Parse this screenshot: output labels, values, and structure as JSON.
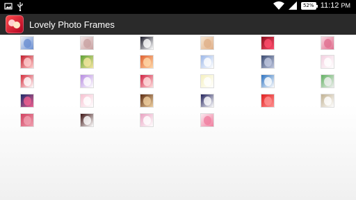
{
  "status_bar": {
    "time": "11:12",
    "time_suffix": "PM",
    "battery": "52%",
    "icons": [
      "gallery-icon",
      "usb-icon",
      "wifi-icon",
      "signal-icon",
      "battery-icon"
    ]
  },
  "action_bar": {
    "title": "Lovely Photo Frames"
  },
  "thumbnails": [
    {
      "color": "#e8eef8",
      "accent": "#6b8fd1"
    },
    {
      "color": "#f3e6e6",
      "accent": "#c9a3a3"
    },
    {
      "color": "#1c1c2a",
      "accent": "#ffffff"
    },
    {
      "color": "#f6e6d2",
      "accent": "#e0b08a"
    },
    {
      "color": "#8a0f1c",
      "accent": "#ff4d6d"
    },
    {
      "color": "#f9d9e2",
      "accent": "#e07090"
    },
    {
      "color": "#c21b2a",
      "accent": "#ffd0d0"
    },
    {
      "color": "#5da033",
      "accent": "#f5e6a0"
    },
    {
      "color": "#e06030",
      "accent": "#ffd8a8"
    },
    {
      "color": "#9bb7e8",
      "accent": "#ffffff"
    },
    {
      "color": "#3a4a70",
      "accent": "#c0c8e0"
    },
    {
      "color": "#f3d0e0",
      "accent": "#ffffff"
    },
    {
      "color": "#d42a3a",
      "accent": "#ffffff"
    },
    {
      "color": "#b68ae0",
      "accent": "#ffffff"
    },
    {
      "color": "#d02040",
      "accent": "#ffe0e0"
    },
    {
      "color": "#f5f0c0",
      "accent": "#ffffff"
    },
    {
      "color": "#2a70c0",
      "accent": "#ffffff"
    },
    {
      "color": "#60b060",
      "accent": "#f0f0f0"
    },
    {
      "color": "#1a2a6a",
      "accent": "#f06090"
    },
    {
      "color": "#f6c0d0",
      "accent": "#ffffff"
    },
    {
      "color": "#5a2a10",
      "accent": "#f0d0a0"
    },
    {
      "color": "#20205a",
      "accent": "#ffffff"
    },
    {
      "color": "#e02020",
      "accent": "#ff9090"
    },
    {
      "color": "#c0b090",
      "accent": "#ffffff"
    },
    {
      "color": "#d04060",
      "accent": "#f0a0b0"
    },
    {
      "color": "#3a1010",
      "accent": "#ffffff"
    },
    {
      "color": "#e8a0c0",
      "accent": "#ffffff"
    },
    {
      "color": "#fbe8ef",
      "accent": "#f080a0"
    }
  ]
}
